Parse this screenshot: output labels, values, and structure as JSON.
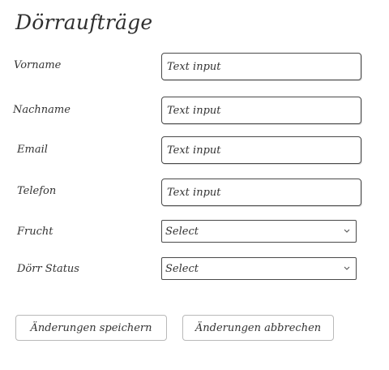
{
  "page": {
    "title": "Dörraufträge"
  },
  "form": {
    "fields": [
      {
        "label": "Vorname",
        "placeholder": "Text input"
      },
      {
        "label": "Nachname",
        "placeholder": "Text input"
      },
      {
        "label": "Email",
        "placeholder": "Text input"
      },
      {
        "label": "Telefon",
        "placeholder": "Text input"
      }
    ],
    "selects": [
      {
        "label": "Frucht",
        "value": "Select"
      },
      {
        "label": "Dörr Status",
        "value": "Select"
      }
    ]
  },
  "actions": {
    "save_label": "Änderungen speichern",
    "cancel_label": "Änderungen abbrechen"
  },
  "icons": {
    "select_chevron": "chevron-down-icon"
  },
  "colors": {
    "text": "#333333",
    "input_border": "#4a4a4a",
    "button_border": "#b9b9b9",
    "background": "#ffffff"
  }
}
